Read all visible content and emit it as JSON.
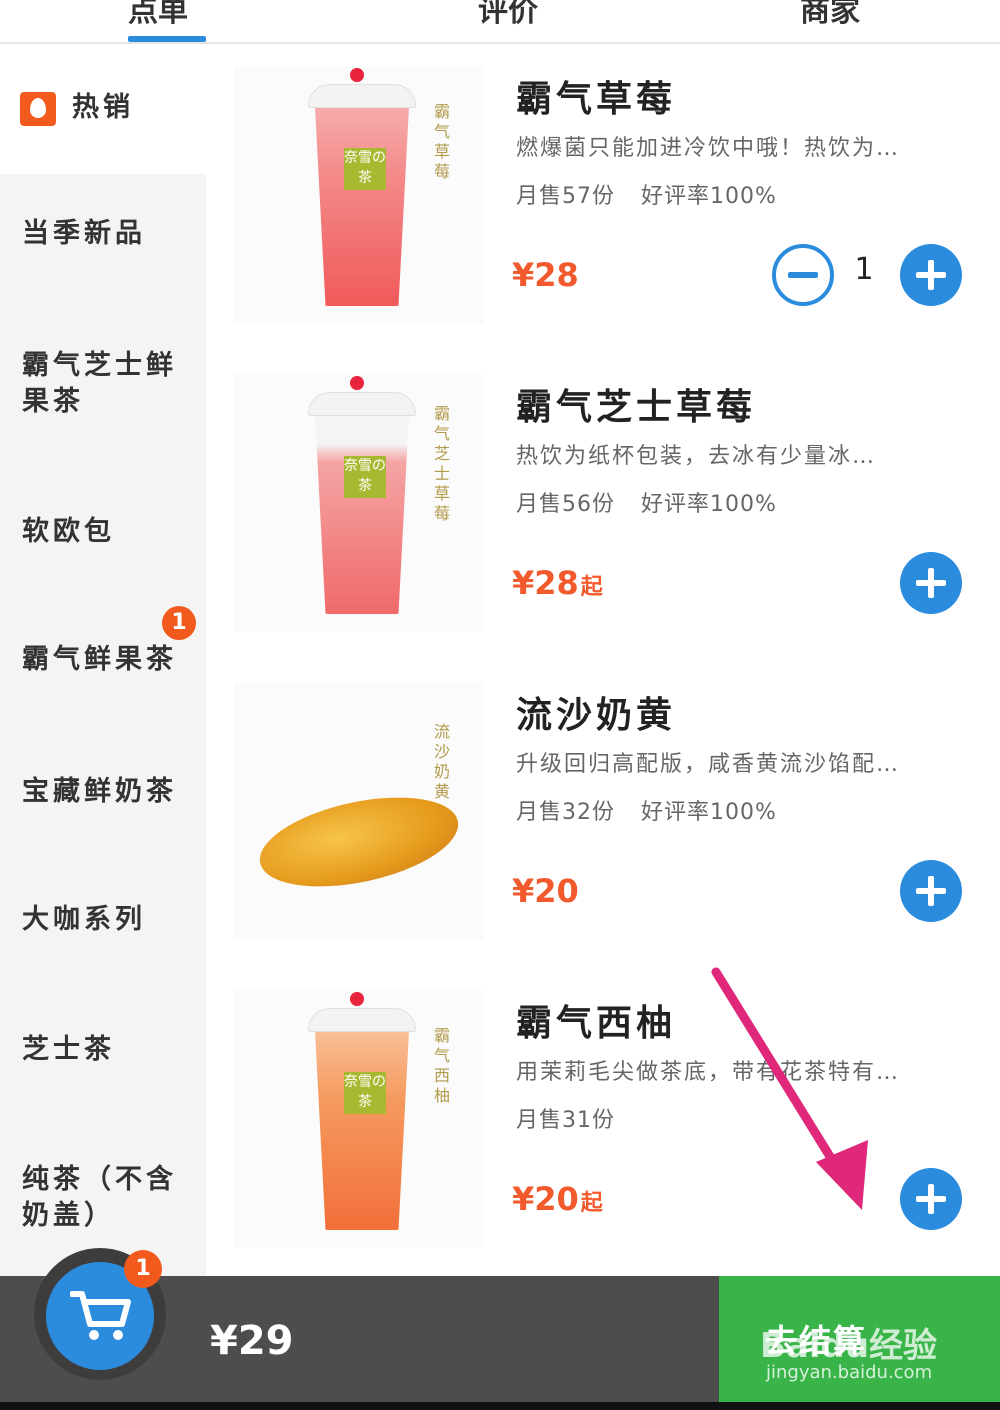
{
  "top_tabs": [
    "点单",
    "评价",
    "商家"
  ],
  "sidebar": {
    "items": [
      {
        "label": "热销",
        "active": true,
        "icon": "flame-icon"
      },
      {
        "label": "当季新品"
      },
      {
        "label": "霸气芝士鲜果茶"
      },
      {
        "label": "软欧包"
      },
      {
        "label": "霸气鲜果茶",
        "badge": "1"
      },
      {
        "label": "宝藏鲜奶茶"
      },
      {
        "label": "大咖系列"
      },
      {
        "label": "芝士茶"
      },
      {
        "label": "纯茶（不含奶盖）"
      }
    ]
  },
  "products": [
    {
      "name": "霸气草莓",
      "desc": "燃爆菌只能加进冷饮中哦！热饮为…",
      "sales": "月售57份",
      "rating": "好评率100%",
      "price": "¥28",
      "price_suffix": "",
      "qty": "1",
      "thumb_text": "霸气草莓"
    },
    {
      "name": "霸气芝士草莓",
      "desc": "热饮为纸杯包装，去冰有少量冰…",
      "sales": "月售56份",
      "rating": "好评率100%",
      "price": "¥28",
      "price_suffix": "起",
      "thumb_text": "霸气芝士草莓"
    },
    {
      "name": "流沙奶黄",
      "desc": "升级回归高配版，咸香黄流沙馅配…",
      "sales": "月售32份",
      "rating": "好评率100%",
      "price": "¥20",
      "price_suffix": "",
      "thumb_text": "流沙奶黄"
    },
    {
      "name": "霸气西柚",
      "desc": "用茉莉毛尖做茶底，带有花茶特有…",
      "sales": "月售31份",
      "rating": "",
      "price": "¥20",
      "price_suffix": "起",
      "thumb_text": "霸气西柚"
    }
  ],
  "cup_brand": "奈雪の茶",
  "cart": {
    "badge": "1",
    "total": "¥29",
    "checkout_label": "去结算"
  },
  "watermark": {
    "text": "Baidu经验",
    "sub": "jingyan.baidu.com"
  },
  "colors": {
    "accent": "#2b8cde",
    "price": "#f25a2e",
    "checkout": "#38b449",
    "badge": "#f25a1d",
    "arrow": "#e0287a"
  }
}
